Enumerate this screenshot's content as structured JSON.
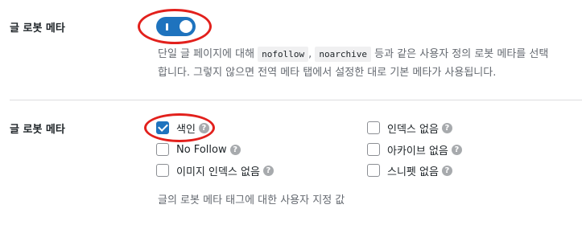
{
  "section1": {
    "label": "글 로봇 메타",
    "toggle_on": true,
    "desc_line1_part1": "단일 글 페이지에 대해 ",
    "code1": "nofollow",
    "desc_line1_comma": ", ",
    "code2": "noarchive",
    "desc_line1_part2": " 등과 같은 사용자 정의 로봇 메타를 선택",
    "desc_line2": "합니다. 그렇지 않으면 전역 메타 탭에서 설정한 대로 기본 메타가 사용됩니다."
  },
  "section2": {
    "label": "글 로봇 메타",
    "options_left": [
      {
        "label": "색인",
        "checked": true
      },
      {
        "label": "No Follow",
        "checked": false
      },
      {
        "label": "이미지 인덱스 없음",
        "checked": false
      }
    ],
    "options_right": [
      {
        "label": "인덱스 없음",
        "checked": false
      },
      {
        "label": "아카이브 없음",
        "checked": false
      },
      {
        "label": "스니펫 없음",
        "checked": false
      }
    ],
    "help_glyph": "?",
    "hint": "글의 로봇 메타 태그에 대한 사용자 지정 값"
  },
  "colors": {
    "accent": "#1e73be",
    "annotation_red": "#e2201c"
  }
}
